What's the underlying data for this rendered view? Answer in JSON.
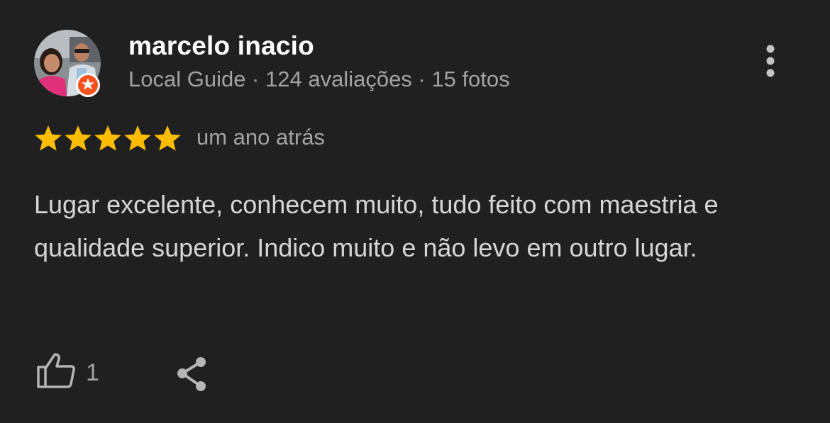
{
  "review": {
    "author": {
      "name": "marcelo inacio",
      "meta": "Local Guide · 124 avaliações · 15 fotos",
      "badge_icon": "local-guide-badge-icon",
      "badge_color": "#f4511e"
    },
    "rating": {
      "stars": 5,
      "max": 5,
      "star_color": "#fbbc04"
    },
    "date": "um ano atrás",
    "text": "Lugar excelente, conhecem muito, tudo feito com maestria e qualidade superior. Indico muito e não levo em outro lugar.",
    "actions": {
      "like_icon": "thumbs-up-icon",
      "like_count": "1",
      "share_icon": "share-icon",
      "menu_icon": "more-vert-icon"
    }
  },
  "theme": {
    "background": "#202020",
    "primary_text": "#ffffff",
    "secondary_text": "#a3a3a3",
    "body_text": "#d6d6d6"
  }
}
